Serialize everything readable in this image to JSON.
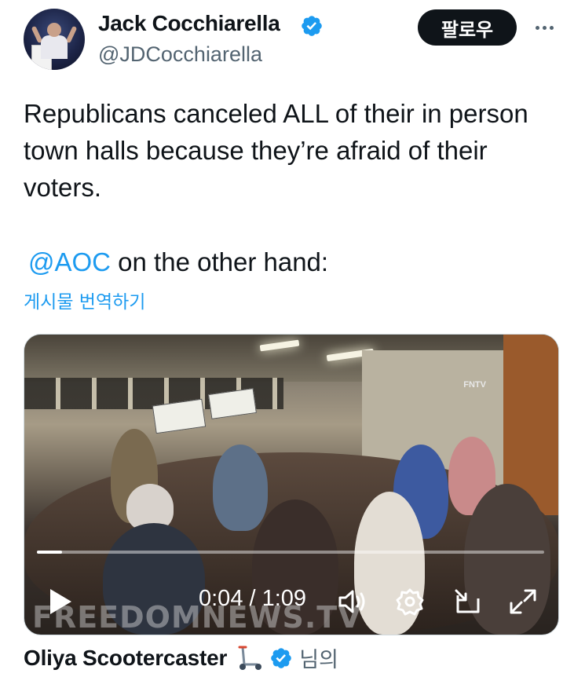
{
  "author": {
    "name": "Jack Cocchiarella",
    "handle": "@JDCocchiarella",
    "verified": true,
    "avatar_icon": "profile-photo-speaker-at-podium"
  },
  "header": {
    "follow_label": "팔로우",
    "more_icon": "more-horizontal-icon"
  },
  "tweet": {
    "line1": "Republicans canceled ALL of their in person town halls because they’re afraid of their voters.",
    "mention": "@AOC",
    "line2_rest": " on the other hand:",
    "translate_label": "게시물 번역하기"
  },
  "video": {
    "time_label": "0:04 / 1:09",
    "progress": 0.05,
    "watermark": "FREEDOMNEWS.TV",
    "channel_bug": "FNTV",
    "controls": [
      "play-icon",
      "volume-icon",
      "settings-gear-icon",
      "picture-in-picture-icon",
      "fullscreen-icon"
    ]
  },
  "footer": {
    "name": "Oliya Scootercaster",
    "emoji_icon": "kick-scooter-icon",
    "verified": true,
    "suffix": "님의"
  },
  "colors": {
    "link": "#1d9bf0",
    "verified_badge": "#1d9bf0",
    "text": "#0f1419",
    "secondary": "#536471",
    "follow_bg": "#0f1419"
  }
}
